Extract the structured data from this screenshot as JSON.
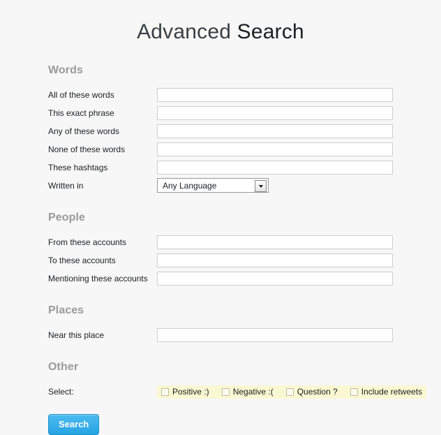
{
  "page": {
    "title_light": "Advanced ",
    "title_strong": "Search",
    "background": "#f7f7f7"
  },
  "sections": {
    "words": {
      "heading": "Words",
      "fields": [
        {
          "label": "All of these words",
          "value": "",
          "placeholder": ""
        },
        {
          "label": "This exact phrase",
          "value": "",
          "placeholder": ""
        },
        {
          "label": "Any of these words",
          "value": "",
          "placeholder": ""
        },
        {
          "label": "None of these words",
          "value": "",
          "placeholder": ""
        },
        {
          "label": "These hashtags",
          "value": "",
          "placeholder": ""
        }
      ],
      "language": {
        "label": "Written in",
        "selected": "Any Language",
        "arrow_icon": "chevron-down-icon"
      }
    },
    "people": {
      "heading": "People",
      "fields": [
        {
          "label": "From these accounts",
          "value": "",
          "placeholder": ""
        },
        {
          "label": "To these accounts",
          "value": "",
          "placeholder": ""
        },
        {
          "label": "Mentioning these accounts",
          "value": "",
          "placeholder": ""
        }
      ]
    },
    "places": {
      "heading": "Places",
      "fields": [
        {
          "label": "Near this place",
          "value": "",
          "placeholder": ""
        }
      ]
    },
    "other": {
      "heading": "Other",
      "select_label": "Select:",
      "highlight_color": "#faf7d2",
      "checkboxes": [
        {
          "label": "Positive :)",
          "checked": false
        },
        {
          "label": "Negative :(",
          "checked": false
        },
        {
          "label": "Question ?",
          "checked": false
        },
        {
          "label": "Include retweets",
          "checked": false
        }
      ]
    }
  },
  "actions": {
    "search_button": "Search",
    "search_button_color": "#26a4e4"
  }
}
